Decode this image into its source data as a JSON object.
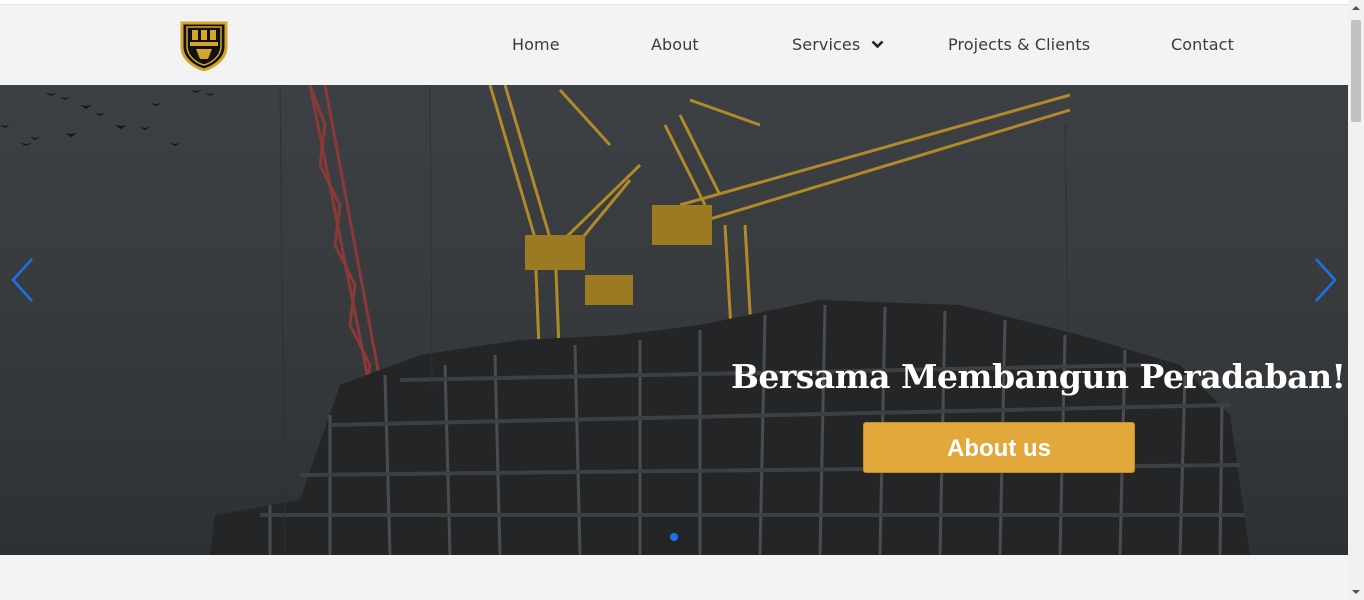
{
  "nav": {
    "home": "Home",
    "about": "About",
    "services": "Services",
    "projects": "Projects & Clients",
    "contact": "Contact"
  },
  "hero": {
    "headline": "Bersama Membangun Peradaban!",
    "button_label": "About us"
  },
  "icons": {
    "logo": "company-shield-logo",
    "services_dropdown": "chevron-down-icon",
    "prev": "chevron-left-icon",
    "next": "chevron-right-icon"
  },
  "carousel": {
    "active_slide": 1,
    "slide_count": 1
  },
  "colors": {
    "accent": "#e3a83b",
    "nav_background": "#f3f3f3",
    "carousel_arrow": "#1a73e8",
    "nav_text": "#3b3b3b"
  }
}
